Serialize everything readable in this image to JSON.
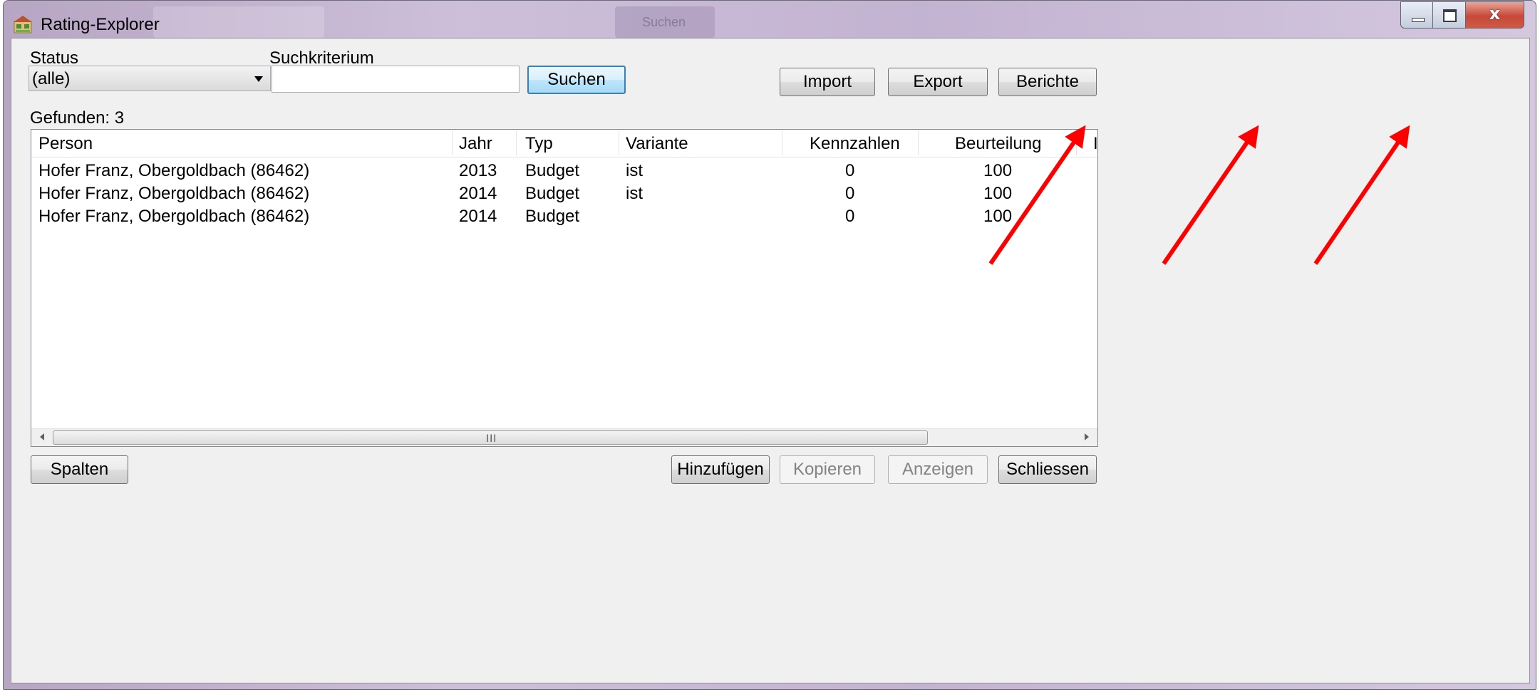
{
  "window": {
    "title": "Rating-Explorer",
    "background_tab_label": "Suchen",
    "close_glyph": "x"
  },
  "filters": {
    "status_label": "Status",
    "status_value": "(alle)",
    "search_label": "Suchkriterium",
    "search_value": "",
    "search_button": "Suchen"
  },
  "actions": {
    "import": "Import",
    "export": "Export",
    "reports": "Berichte"
  },
  "results": {
    "found_label": "Gefunden: 3"
  },
  "table": {
    "columns": [
      "Person",
      "Jahr",
      "Typ",
      "Variante",
      "Kennzahlen",
      "Beurteilung",
      "I"
    ],
    "rows": [
      [
        "Hofer Franz, Obergoldbach (86462)",
        "2013",
        "Budget",
        "ist",
        "0",
        "100"
      ],
      [
        "Hofer Franz, Obergoldbach (86462)",
        "2014",
        "Budget",
        "ist",
        "0",
        "100"
      ],
      [
        "Hofer Franz, Obergoldbach (86462)",
        "2014",
        "Budget",
        "",
        "0",
        "100"
      ]
    ],
    "scroll_grip": "III"
  },
  "footer": {
    "columns_button": "Spalten",
    "add_button": "Hinzufügen",
    "copy_button": "Kopieren",
    "show_button": "Anzeigen",
    "close_button": "Schliessen"
  },
  "colors": {
    "annotation_arrow": "#ff0000",
    "default_button_border": "#3c7fb1",
    "title_bar": "#c6b7d4"
  },
  "icons": {
    "app": "rating-explorer-app-icon",
    "combo": "chevron-down-icon",
    "annotation": "red-arrow-icon"
  }
}
